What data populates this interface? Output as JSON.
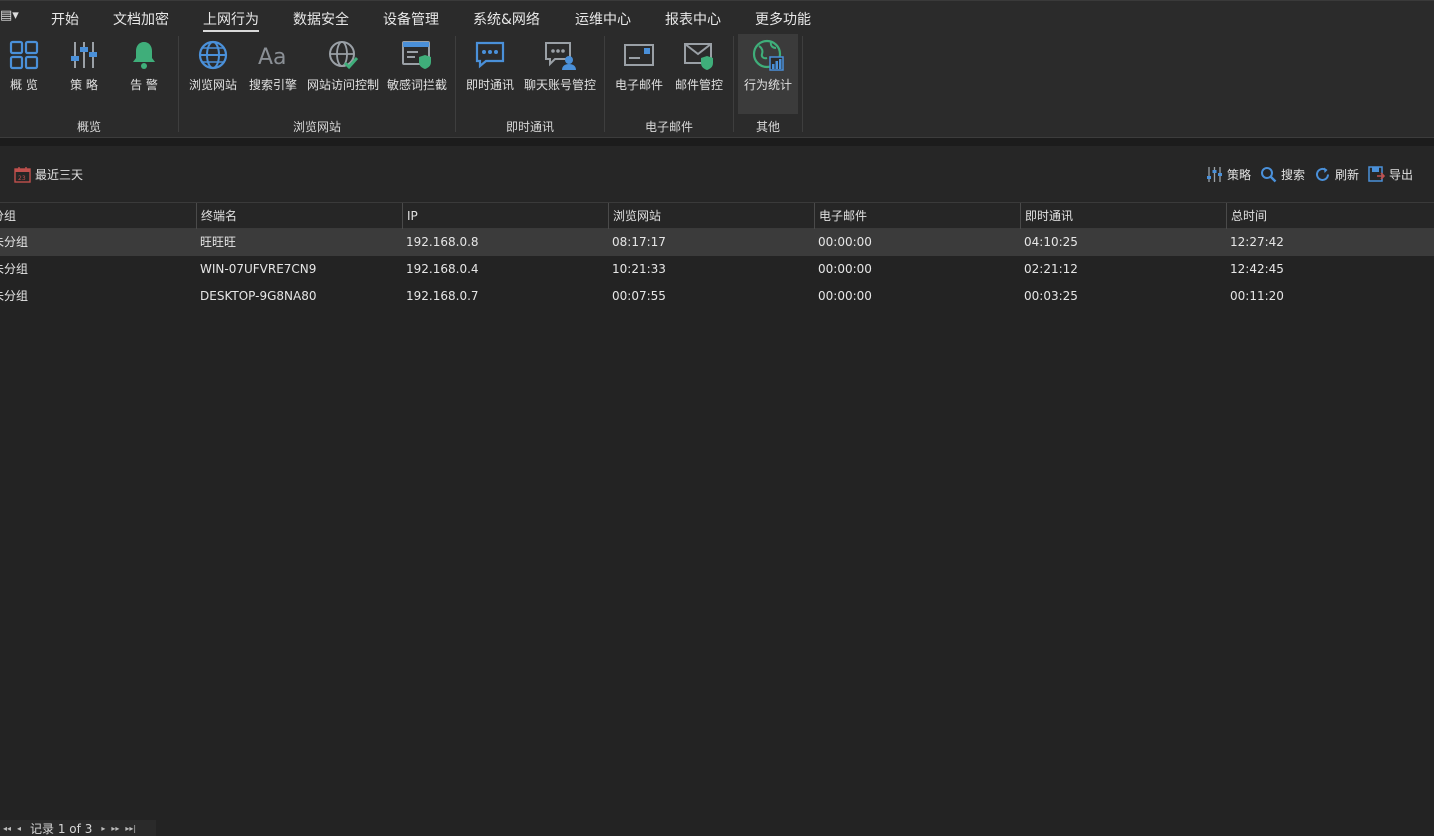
{
  "menu": {
    "app_button": "▤▾",
    "tabs": [
      "开始",
      "文档加密",
      "上网行为",
      "数据安全",
      "设备管理",
      "系统&网络",
      "运维中心",
      "报表中心",
      "更多功能"
    ],
    "active_tab": "上网行为"
  },
  "ribbon": {
    "groups": [
      {
        "label": "概览",
        "items": [
          {
            "label": "概 览",
            "icon": "grid-icon"
          },
          {
            "label": "策 略",
            "icon": "sliders-icon"
          },
          {
            "label": "告 警",
            "icon": "bell-icon"
          }
        ]
      },
      {
        "label": "浏览网站",
        "items": [
          {
            "label": "浏览网站",
            "icon": "globe-icon"
          },
          {
            "label": "搜索引擎",
            "icon": "font-aa-icon"
          },
          {
            "label": "网站访问控制",
            "icon": "globe-check-icon"
          },
          {
            "label": "敏感词拦截",
            "icon": "browser-shield-icon"
          }
        ]
      },
      {
        "label": "即时通讯",
        "items": [
          {
            "label": "即时通讯",
            "icon": "chat-icon"
          },
          {
            "label": "聊天账号管控",
            "icon": "chat-user-icon"
          }
        ]
      },
      {
        "label": "电子邮件",
        "items": [
          {
            "label": "电子邮件",
            "icon": "mail-icon"
          },
          {
            "label": "邮件管控",
            "icon": "mail-shield-icon"
          }
        ]
      },
      {
        "label": "其他",
        "items": [
          {
            "label": "行为统计",
            "icon": "globe-stats-icon"
          }
        ]
      }
    ]
  },
  "toolbar": {
    "date_range": "最近三天",
    "policy": "策略",
    "search": "搜索",
    "refresh": "刷新",
    "export": "导出"
  },
  "table": {
    "columns": [
      "分组",
      "终端名",
      "IP",
      "浏览网站",
      "电子邮件",
      "即时通讯",
      "总时间"
    ],
    "rows": [
      [
        "未分组",
        "旺旺旺",
        "192.168.0.8",
        "08:17:17",
        "00:00:00",
        "04:10:25",
        "12:27:42"
      ],
      [
        "未分组",
        "WIN-07UFVRE7CN9",
        "192.168.0.4",
        "10:21:33",
        "00:00:00",
        "02:21:12",
        "12:42:45"
      ],
      [
        "未分组",
        "DESKTOP-9G8NA80",
        "192.168.0.7",
        "00:07:55",
        "00:00:00",
        "00:03:25",
        "00:11:20"
      ]
    ]
  },
  "pager": {
    "text": "记录 1 of 3"
  },
  "colors": {
    "accent_blue": "#4a90d9",
    "accent_green": "#3fae7a",
    "background": "#232323"
  }
}
